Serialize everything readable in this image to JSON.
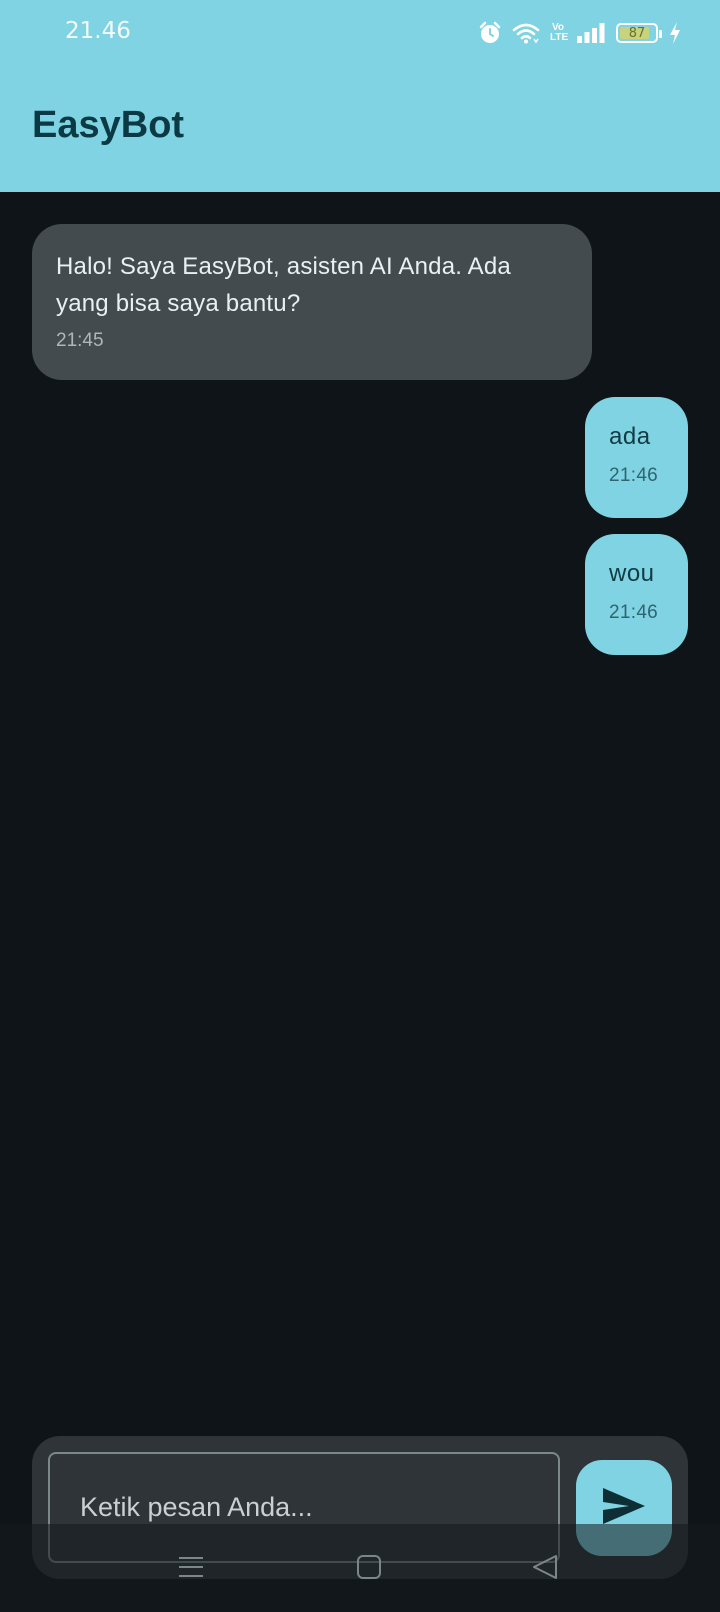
{
  "status_bar": {
    "time": "21.46",
    "volte_label": "Vo LTE",
    "battery_level": 87,
    "battery_text": "87",
    "icons": [
      "alarm-icon",
      "wifi-icon",
      "volte-icon",
      "signal-icon",
      "battery-icon",
      "charging-icon"
    ]
  },
  "app_bar": {
    "title": "EasyBot",
    "color": "#7fd3e2"
  },
  "messages": [
    {
      "sender": "bot",
      "text": "Halo! Saya EasyBot, asisten AI Anda. Ada yang bisa saya bantu?",
      "time": "21:45"
    },
    {
      "sender": "user",
      "text": "ada",
      "time": "21:46"
    },
    {
      "sender": "user",
      "text": "wou",
      "time": "21:46"
    }
  ],
  "composer": {
    "placeholder": "Ketik pesan Anda...",
    "send_icon": "send-icon"
  },
  "navigation": {
    "icons": [
      "menu-icon",
      "home-icon",
      "back-icon"
    ]
  },
  "colors": {
    "accent": "#7fd3e2",
    "background": "#0f1418",
    "bot_bubble": "#444b4f",
    "title_text": "#0c3a44"
  }
}
